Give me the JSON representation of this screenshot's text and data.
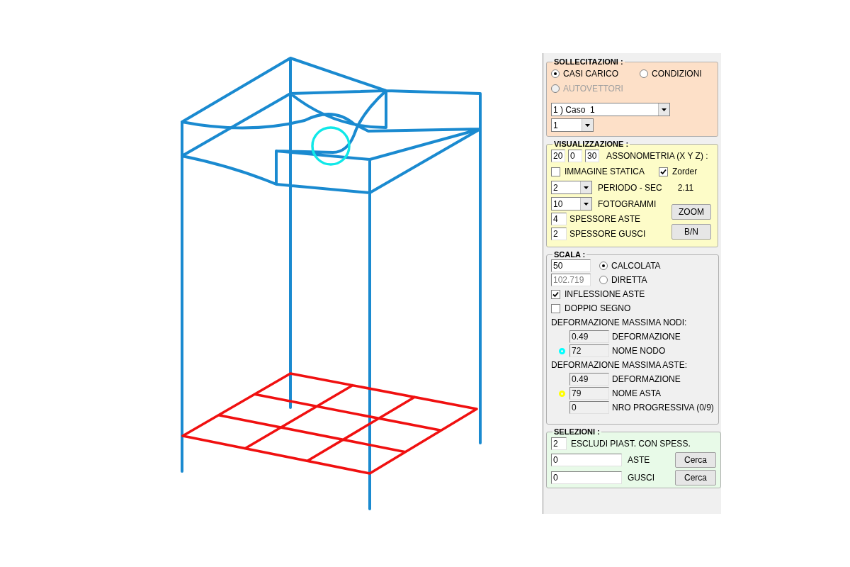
{
  "sollecitazioni": {
    "title": "SOLLECITAZIONI :",
    "options": [
      {
        "label": "CASI CARICO",
        "selected": true,
        "disabled": false
      },
      {
        "label": "CONDIZIONI",
        "selected": false,
        "disabled": false
      },
      {
        "label": "AUTOVETTORI",
        "selected": false,
        "disabled": true
      }
    ],
    "case_select": "1 ) Caso  1",
    "sub_select": "1"
  },
  "visualizzazione": {
    "title": "VISUALIZZAZIONE :",
    "angles": [
      "20",
      "0",
      "30"
    ],
    "angles_label": "ASSONOMETRIA (X Y Z) :",
    "checks": [
      {
        "label": "IMMAGINE STATICA",
        "checked": false
      },
      {
        "label": "Zorder",
        "checked": true
      }
    ],
    "period_select": "2",
    "period_label": "PERIODO - SEC",
    "period_value": "2.11",
    "frames_select": "10",
    "frames_label": "FOTOGRAMMI",
    "thickness": [
      {
        "value": "4",
        "label": "SPESSORE ASTE"
      },
      {
        "value": "2",
        "label": "SPESSORE GUSCI"
      }
    ],
    "buttons": [
      "ZOOM",
      "B/N"
    ]
  },
  "scala": {
    "title": "SCALA :",
    "scale_options": [
      {
        "value": "50",
        "label": "CALCOLATA",
        "selected": true,
        "disabled": false
      },
      {
        "value": "102.719",
        "label": "DIRETTA",
        "selected": false,
        "disabled": true
      }
    ],
    "checks": [
      {
        "label": "INFLESSIONE ASTE",
        "checked": true
      },
      {
        "label": "DOPPIO SEGNO",
        "checked": false
      }
    ],
    "sections": [
      {
        "heading": "DEFORMAZIONE MASSIMA NODI:",
        "rows": [
          {
            "value": "0.49",
            "label": "DEFORMAZIONE"
          },
          {
            "value": "72",
            "label": "NOME NODO",
            "color": "#00ffff"
          }
        ]
      },
      {
        "heading": "DEFORMAZIONE MASSIMA ASTE:",
        "rows": [
          {
            "value": "0.49",
            "label": "DEFORMAZIONE"
          },
          {
            "value": "79",
            "label": "NOME ASTA",
            "color": "#ffff00"
          },
          {
            "value": "0",
            "label": "NRO PROGRESSIVA (0/9)"
          }
        ]
      }
    ]
  },
  "selezioni": {
    "title": "SELEZIONI :",
    "exclude": {
      "value": "2",
      "label": "ESCLUDI PIAST. CON SPESS."
    },
    "searches": [
      {
        "value": "0",
        "label": "ASTE",
        "button": "Cerca"
      },
      {
        "value": "0",
        "label": "GUSCI",
        "button": "Cerca"
      }
    ]
  }
}
